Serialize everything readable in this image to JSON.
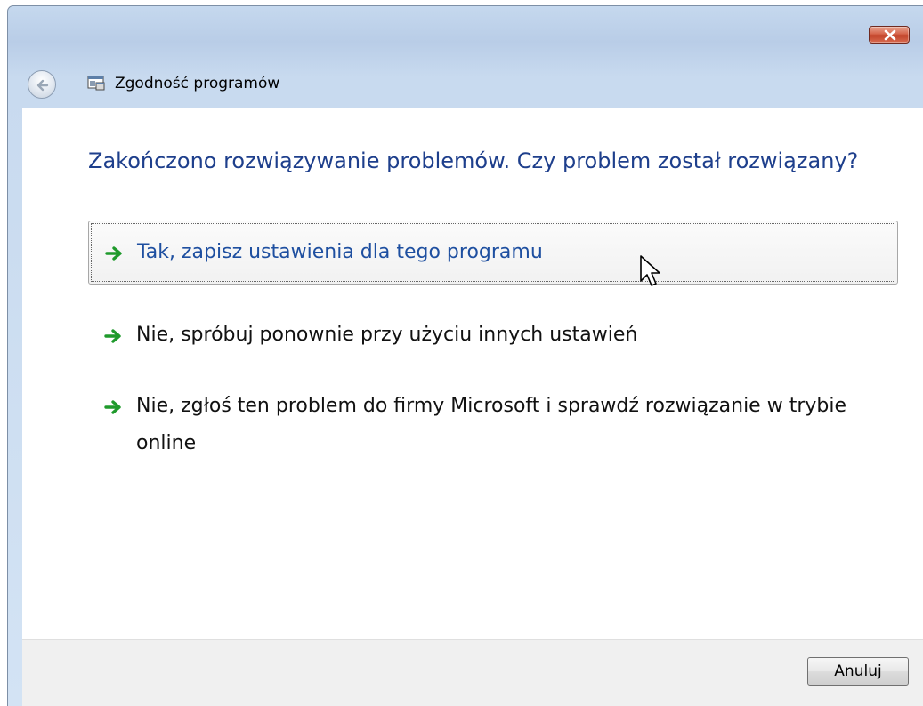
{
  "window": {
    "title": "Zgodność programów"
  },
  "main": {
    "heading": "Zakończono rozwiązywanie problemów. Czy problem został rozwiązany?",
    "options": [
      {
        "label": "Tak, zapisz ustawienia dla tego programu",
        "icon": "green-arrow-icon"
      },
      {
        "label": "Nie, spróbuj ponownie przy użyciu innych ustawień",
        "icon": "green-arrow-icon"
      },
      {
        "label": "Nie, zgłoś ten problem do firmy Microsoft i sprawdź rozwiązanie w trybie online",
        "icon": "green-arrow-icon"
      }
    ]
  },
  "footer": {
    "cancel_label": "Anuluj"
  },
  "colors": {
    "heading": "#1e3f8c",
    "focused_option": "#1e4fa0",
    "arrow": "#1f9a2c",
    "close_button": "#c9472c"
  }
}
